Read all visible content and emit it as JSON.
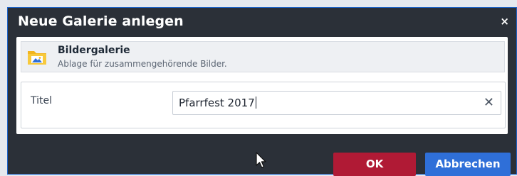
{
  "dialog": {
    "title": "Neue Galerie anlegen",
    "close_glyph": "×"
  },
  "type_option": {
    "name": "Bildergalerie",
    "description": "Ablage für zusammengehörende Bilder.",
    "icon": "folder-image-icon"
  },
  "form": {
    "title_label": "Titel",
    "title_value": "Pfarrfest 2017",
    "clear_glyph": "✕"
  },
  "buttons": {
    "ok_label": "OK",
    "cancel_label": "Abbrechen"
  },
  "colors": {
    "dialog_bg": "#2b3038",
    "ok_button": "#b01a35",
    "cancel_button": "#2f6fd8",
    "dialog_border": "#1d63c9"
  }
}
